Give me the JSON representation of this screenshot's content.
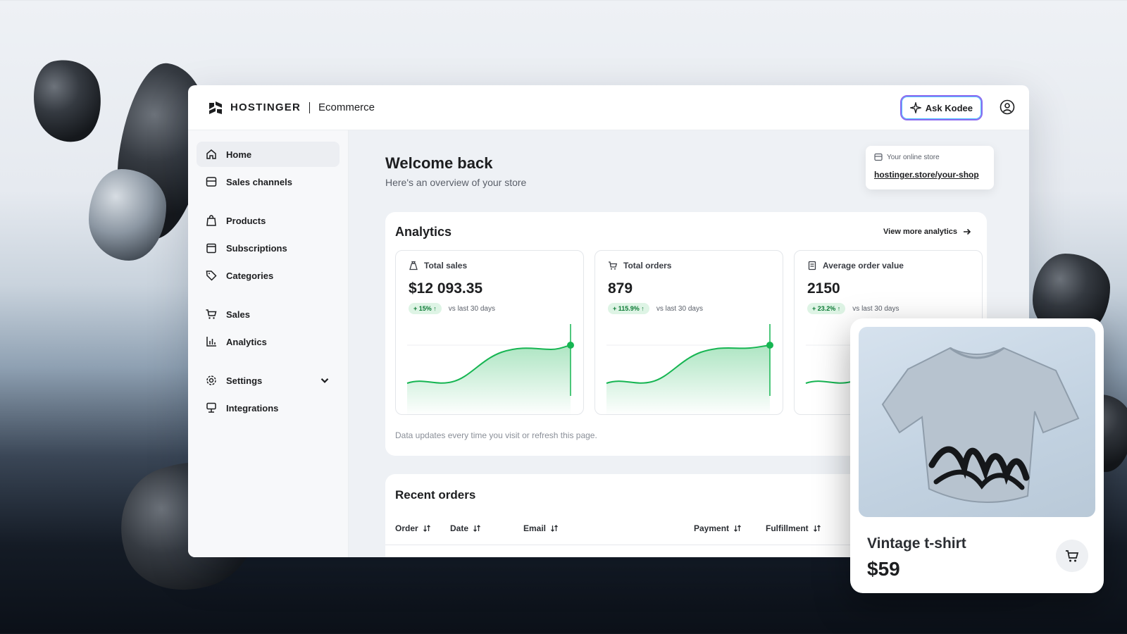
{
  "colors": {
    "accent_green": "#16b552",
    "ask_border": "#8c6bf0",
    "text": "#1d1e20"
  },
  "header": {
    "brand": "HOSTINGER",
    "product": "Ecommerce",
    "ask_label": "Ask Kodee",
    "ask_icon": "sparkle-icon",
    "account_icon": "user-circle-icon"
  },
  "sidebar": {
    "items": [
      {
        "label": "Home",
        "icon": "home-icon"
      },
      {
        "label": "Sales channels",
        "icon": "store-icon"
      },
      {
        "label": "Products",
        "icon": "bag-icon"
      },
      {
        "label": "Subscriptions",
        "icon": "calendar-icon"
      },
      {
        "label": "Categories",
        "icon": "tag-icon"
      },
      {
        "label": "Sales",
        "icon": "cart-icon"
      },
      {
        "label": "Analytics",
        "icon": "bar-chart-icon"
      },
      {
        "label": "Settings",
        "icon": "gear-icon"
      },
      {
        "label": "Integrations",
        "icon": "plug-icon"
      }
    ]
  },
  "main": {
    "welcome_title": "Welcome back",
    "welcome_sub": "Here's an overview of your store",
    "store_label": "Your online store",
    "store_url": "hostinger.store/your-shop"
  },
  "analytics": {
    "title": "Analytics",
    "view_more": "View more analytics",
    "note": "Data updates every time you visit or refresh this page.",
    "cards": [
      {
        "label": "Total sales",
        "value": "$12 093.35",
        "change": "+ 15%",
        "vs": "vs last 30 days"
      },
      {
        "label": "Total orders",
        "value": "879",
        "change": "+ 115.9%",
        "vs": "vs last 30 days"
      },
      {
        "label": "Average order value",
        "value": "2150",
        "change": "+ 23.2%",
        "vs": "vs last 30 days"
      }
    ]
  },
  "orders": {
    "title": "Recent orders",
    "columns": [
      "Order",
      "Date",
      "Email",
      "Payment",
      "Fulfillment"
    ]
  },
  "product": {
    "name": "Vintage t-shirt",
    "price": "$59"
  }
}
